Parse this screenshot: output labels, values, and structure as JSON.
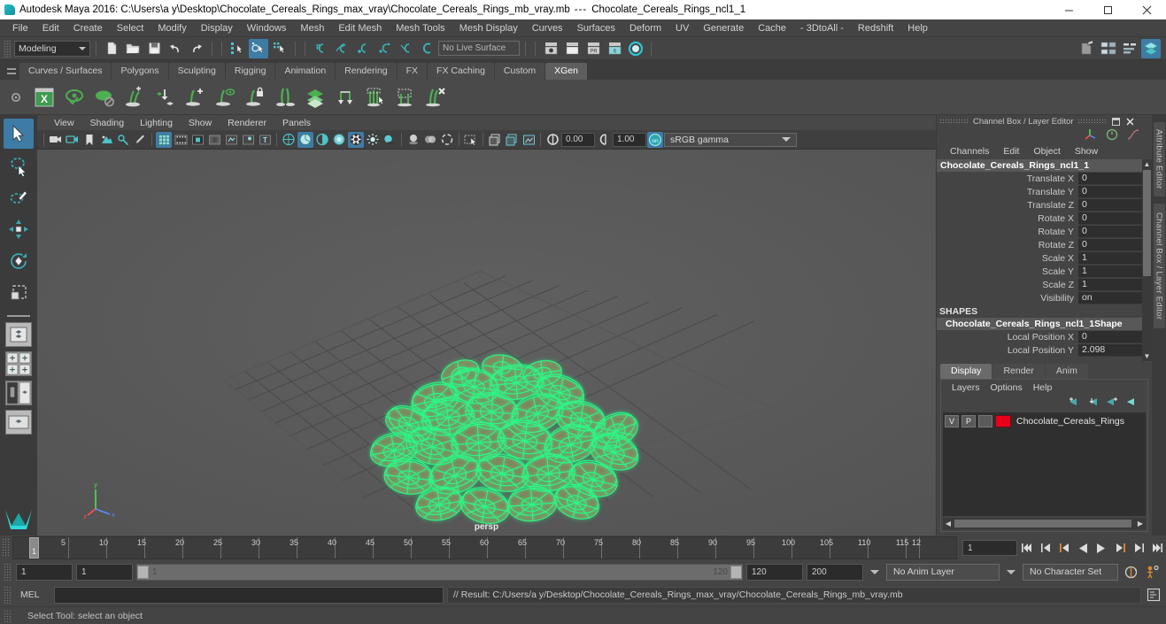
{
  "window": {
    "title": "Autodesk Maya 2016: C:\\Users\\a y\\Desktop\\Chocolate_Cereals_Rings_max_vray\\Chocolate_Cereals_Rings_mb_vray.mb",
    "title_sep": "---",
    "active_object": "Chocolate_Cereals_Rings_ncl1_1",
    "minimize": "—",
    "maximize": "❐",
    "close": "✕"
  },
  "menubar": {
    "items": [
      "File",
      "Edit",
      "Create",
      "Select",
      "Modify",
      "Display",
      "Windows",
      "Mesh",
      "Edit Mesh",
      "Mesh Tools",
      "Mesh Display",
      "Curves",
      "Surfaces",
      "Deform",
      "UV",
      "Generate",
      "Cache",
      "- 3DtoAll -",
      "Redshift",
      "Help"
    ]
  },
  "statusline": {
    "mode": "Modeling",
    "live_surface": "No Live Surface",
    "icons": [
      "new-scene-icon",
      "open-scene-icon",
      "save-scene-icon",
      "undo-icon",
      "redo-icon",
      "select-by-hierarchy-icon",
      "select-by-object-icon",
      "select-by-component-icon",
      "snap-to-grid-icon",
      "snap-to-curve-icon",
      "snap-to-point-icon",
      "snap-to-projected-center-icon",
      "snap-to-view-plane-icon",
      "make-live-icon",
      "render-current-frame-icon",
      "ipr-render-icon",
      "render-settings-icon",
      "hypershade-icon",
      "render-view-icon",
      "toggle-uv-editor-icon",
      "toggle-attribute-editor-icon",
      "toggle-tool-settings-icon",
      "toggle-channel-box-icon"
    ]
  },
  "shelf": {
    "tabs": [
      "Curves / Surfaces",
      "Polygons",
      "Sculpting",
      "Rigging",
      "Animation",
      "Rendering",
      "FX",
      "FX Caching",
      "Custom",
      "XGen"
    ],
    "active_tab": "XGen",
    "icons": [
      "xgen-window-icon",
      "xgen-preview-icon",
      "xgen-disable-preview-icon",
      "xgen-add-guides-icon",
      "xgen-place-guide-icon",
      "xgen-add-guide-plus-icon",
      "xgen-guide-eye-icon",
      "xgen-lock-guide-icon",
      "xgen-mirror-guides-icon",
      "xgen-layers-icon",
      "xgen-convert-guides-icon",
      "xgen-select-guides-icon",
      "xgen-region-select-icon",
      "xgen-delete-guides-icon"
    ]
  },
  "toolbox": {
    "items": [
      "select-tool",
      "lasso-select-tool",
      "paint-select-tool",
      "move-tool",
      "rotate-tool",
      "scale-tool"
    ],
    "layouts": [
      "single-pane-layout",
      "four-pane-layout",
      "two-pane-stacked-layout",
      "persp-outliner-layout",
      "maya-logo"
    ]
  },
  "viewport": {
    "menus": [
      "View",
      "Shading",
      "Lighting",
      "Show",
      "Renderer",
      "Panels"
    ],
    "camera_label": "persp",
    "exposure": "0.00",
    "gamma": "1.00",
    "color_management": "sRGB gamma",
    "toolbar_icons": [
      "select-camera-icon",
      "lock-camera-icon",
      "bookmark-icon",
      "image-plane-icon",
      "two-d-pan-zoom-icon",
      "grease-pencil-icon",
      "grid-toggle-icon",
      "film-gate-icon",
      "resolution-gate-icon",
      "gate-mask-icon",
      "xray-joints-icon",
      "xray-icon",
      "texture-border-icon",
      "wireframe-icon",
      "smooth-shade-all-icon",
      "shaded-wireframe-icon",
      "use-default-material-icon",
      "textured-icon",
      "use-all-lights-icon",
      "shadows-icon",
      "screen-space-ao-icon",
      "motion-blur-icon",
      "multisample-icon",
      "isolate-select-icon",
      "grid-display-icon",
      "film-gate-2-icon",
      "view-gate-icon",
      "exposure-icon",
      "gamma-icon",
      "color-management-icon"
    ],
    "scene": {
      "object": "Chocolate_Cereals_Rings_ncl1_1",
      "wireframe_color": "#28ff88",
      "selected": true,
      "grid_color": "#4a4a4a",
      "background_color": "#5a5a5a"
    }
  },
  "channelbox": {
    "panel_title": "Channel Box / Layer Editor",
    "menus": [
      "Channels",
      "Edit",
      "Object",
      "Show"
    ],
    "object_name": "Chocolate_Cereals_Rings_ncl1_1",
    "attributes": [
      {
        "label": "Translate X",
        "value": "0"
      },
      {
        "label": "Translate Y",
        "value": "0"
      },
      {
        "label": "Translate Z",
        "value": "0"
      },
      {
        "label": "Rotate X",
        "value": "0"
      },
      {
        "label": "Rotate Y",
        "value": "0"
      },
      {
        "label": "Rotate Z",
        "value": "0"
      },
      {
        "label": "Scale X",
        "value": "1"
      },
      {
        "label": "Scale Y",
        "value": "1"
      },
      {
        "label": "Scale Z",
        "value": "1"
      },
      {
        "label": "Visibility",
        "value": "on"
      }
    ],
    "shapes_header": "SHAPES",
    "shape_name": "Chocolate_Cereals_Rings_ncl1_1Shape",
    "shape_attributes": [
      {
        "label": "Local Position X",
        "value": "0"
      },
      {
        "label": "Local Position Y",
        "value": "2.098"
      }
    ]
  },
  "layereditor": {
    "tabs": [
      "Display",
      "Render",
      "Anim"
    ],
    "active_tab": "Display",
    "menus": [
      "Layers",
      "Options",
      "Help"
    ],
    "icons": [
      "move-layer-up-icon",
      "move-layer-down-icon",
      "new-layer-from-selected-icon",
      "new-layer-icon"
    ],
    "layers": [
      {
        "visibility": "V",
        "playback": "P",
        "shading": "",
        "color": "#e8001a",
        "name": "Chocolate_Cereals_Rings"
      }
    ]
  },
  "rightdock": {
    "tabs": [
      "Attribute Editor",
      "Channel Box / Layer Editor"
    ]
  },
  "timeslider": {
    "start": 1,
    "end": 120,
    "current": "1",
    "tick_labels": [
      5,
      10,
      15,
      20,
      25,
      30,
      35,
      40,
      45,
      50,
      55,
      60,
      65,
      70,
      75,
      80,
      85,
      90,
      95,
      100,
      105,
      110,
      115,
      "12"
    ],
    "playback_buttons": [
      "go-to-start-icon",
      "step-back-key-icon",
      "step-back-frame-icon",
      "play-backwards-icon",
      "play-forwards-icon",
      "step-forward-frame-icon",
      "step-forward-key-icon",
      "go-to-end-icon"
    ]
  },
  "rangeslider": {
    "anim_start": "1",
    "range_start": "1",
    "bar_start_label": "1",
    "bar_end_label": "120",
    "range_end": "120",
    "anim_end": "200",
    "anim_layer": "No Anim Layer",
    "character_set": "No Character Set",
    "icons": [
      "auto-keyframe-icon",
      "animation-preferences-icon"
    ]
  },
  "commandline": {
    "language": "MEL",
    "input_value": "",
    "result": "// Result: C:/Users/a y/Desktop/Chocolate_Cereals_Rings_max_vray/Chocolate_Cereals_Rings_mb_vray.mb",
    "script_editor_icon": "script-editor-icon"
  },
  "helpline": {
    "text": "Select Tool: select an object"
  },
  "colors": {
    "accent_blue": "#3e7ca6",
    "teal": "#2fb6b6",
    "wire_green": "#28ff88",
    "layer_red": "#e8001a",
    "orange": "#e08a2a"
  }
}
